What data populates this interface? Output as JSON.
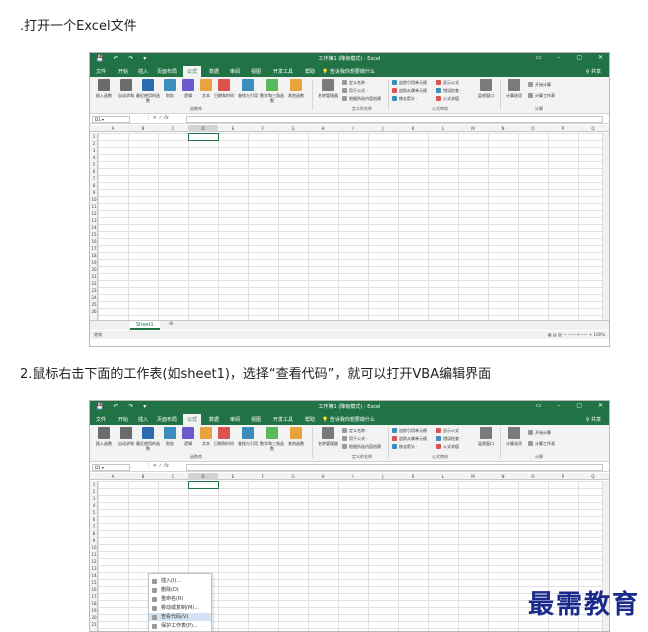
{
  "step1": {
    "text": ".打开一个Excel文件"
  },
  "step2": {
    "text": "2.鼠标右击下面的工作表(如sheet1)，选择“查看代码”，就可以打开VBA编辑界面"
  },
  "excel": {
    "title": "工作簿1 (降级模式) - Excel",
    "accent": "#217346",
    "menu_tabs": [
      "文件",
      "开始",
      "插入",
      "页面布局",
      "公式",
      "数据",
      "审阅",
      "视图",
      "开发工具",
      "帮助"
    ],
    "active_tab": "公式",
    "tell_me": "告诉我你想要做什么",
    "share": "共享",
    "ribbon_buttons": [
      {
        "label": "插入函数",
        "color": "#6b6b6b",
        "icon": "fx-icon"
      },
      {
        "label": "自动求和",
        "color": "#6b6b6b",
        "icon": "sigma-icon"
      },
      {
        "label": "最近使用的函数",
        "color": "#2b6cb0",
        "icon": "star-icon"
      },
      {
        "label": "财务",
        "color": "#3c8dbc",
        "icon": "finance-icon"
      },
      {
        "label": "逻辑",
        "color": "#6a5acd",
        "icon": "logic-icon"
      },
      {
        "label": "文本",
        "color": "#e8a33d",
        "icon": "text-icon"
      },
      {
        "label": "日期和时间",
        "color": "#d9534f",
        "icon": "clock-icon"
      },
      {
        "label": "查找与引用",
        "color": "#3c8dbc",
        "icon": "search-icon"
      },
      {
        "label": "数学和三角函数",
        "color": "#5cb85c",
        "icon": "theta-icon"
      },
      {
        "label": "其他函数",
        "color": "#e8a33d",
        "icon": "more-icon"
      },
      {
        "label": "名称管理器",
        "color": "#7a7a7a",
        "icon": "tag-icon"
      }
    ],
    "group_library": "函数库",
    "defined_names": [
      "定义名称 ·",
      "用于公式 ·",
      "根据所选内容创建"
    ],
    "group_names": "定义的名称",
    "auditing": [
      "追踪引用单元格",
      "追踪从属单元格",
      "移去箭头 ·",
      "显示公式",
      "错误检查 ·",
      "公式求值"
    ],
    "group_auditing": "公式审核",
    "watch": "监视窗口",
    "calc_options": "计算选项",
    "calc": [
      "开始计算",
      "计算工作表"
    ],
    "group_calc": "计算",
    "name_box": "D1",
    "fx": "fx",
    "columns": [
      "A",
      "B",
      "C",
      "D",
      "E",
      "F",
      "G",
      "H",
      "I",
      "J",
      "K",
      "L",
      "M",
      "N",
      "O",
      "P",
      "Q"
    ],
    "rows": [
      "1",
      "2",
      "3",
      "4",
      "5",
      "6",
      "7",
      "8",
      "9",
      "10",
      "11",
      "12",
      "13",
      "14",
      "15",
      "16",
      "17",
      "18",
      "19",
      "20",
      "21",
      "22",
      "23",
      "24",
      "25",
      "26"
    ],
    "sheet_tab": "Sheet1",
    "add_sheet": "⊕",
    "status_ready": "就绪",
    "zoom": "100%"
  },
  "context_menu": {
    "items": [
      "插入(I)...",
      "删除(D)",
      "重命名(R)",
      "移动或复制(M)...",
      "查看代码(V)",
      "保护工作表(P)..."
    ],
    "highlighted": "查看代码(V)"
  },
  "watermark": "最需教育"
}
